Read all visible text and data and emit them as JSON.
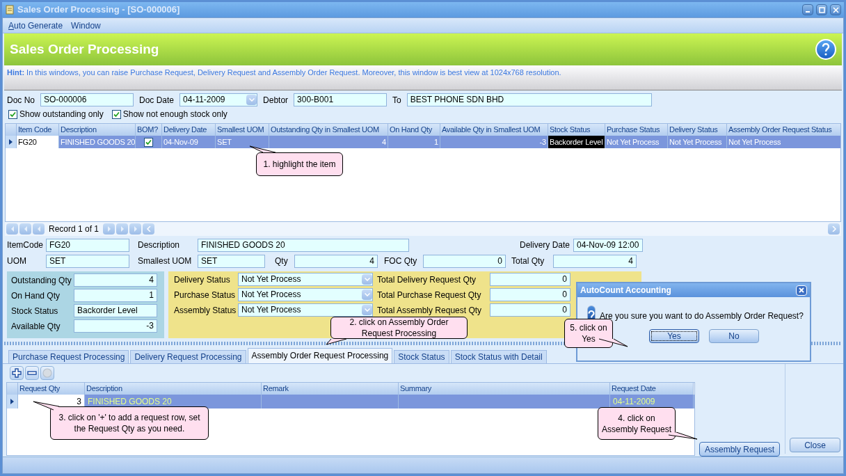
{
  "window": {
    "title": "Sales Order Processing - [SO-000006]"
  },
  "menu": [
    {
      "label": "Auto Generate",
      "mnemonic": true
    },
    {
      "label": "Window",
      "mnemonic": false
    }
  ],
  "header": {
    "title": "Sales Order Processing"
  },
  "hint": {
    "label": "Hint:",
    "text": "In this windows, you can raise Purchase Request, Delivery Request and Assembly Order Request. Moreover, this window is best view at 1024x768 resolution."
  },
  "doc_fields": [
    {
      "label": "Doc No",
      "value": "SO-000006",
      "kind": "text"
    },
    {
      "label": "Doc Date",
      "value": "04-11-2009",
      "kind": "date"
    },
    {
      "label": "Debtor",
      "value": "300-B001",
      "kind": "text"
    },
    {
      "label": "To",
      "value": "BEST PHONE SDN BHD",
      "kind": "wide"
    }
  ],
  "filters": [
    {
      "label": "Show outstanding only",
      "checked": true
    },
    {
      "label": "Show not enough stock only",
      "checked": true
    }
  ],
  "grid": {
    "columns": [
      {
        "label": "Item Code",
        "kind": "text"
      },
      {
        "label": "Description",
        "kind": "text"
      },
      {
        "label": "BOM?",
        "kind": "check"
      },
      {
        "label": "Delivery Date",
        "kind": "text"
      },
      {
        "label": "Smallest UOM",
        "kind": "text"
      },
      {
        "label": "Outstanding Qty in Smallest UOM",
        "kind": "number"
      },
      {
        "label": "On Hand Qty",
        "kind": "number"
      },
      {
        "label": "Available Qty in Smallest UOM",
        "kind": "number"
      },
      {
        "label": "Stock Status",
        "kind": "text"
      },
      {
        "label": "Purchase Status",
        "kind": "text"
      },
      {
        "label": "Delivery Status",
        "kind": "text"
      },
      {
        "label": "Assembly Order Request Status",
        "kind": "text"
      }
    ],
    "rows": [
      {
        "selected": true,
        "cells": [
          {
            "text": "FG20",
            "focused": true
          },
          {
            "text": "FINISHED GOODS 20"
          },
          {
            "checked": true
          },
          {
            "text": "04-Nov-09"
          },
          {
            "text": "SET"
          },
          {
            "text": "4"
          },
          {
            "text": "1"
          },
          {
            "text": "-3"
          },
          {
            "text": "Backorder Level",
            "highlighted": true
          },
          {
            "text": "Not Yet Process"
          },
          {
            "text": "Not Yet Process"
          },
          {
            "text": "Not Yet Process"
          }
        ]
      }
    ]
  },
  "navigator": {
    "text": "Record 1 of 1"
  },
  "detail": {
    "item_code": {
      "label": "ItemCode",
      "value": "FG20"
    },
    "description": {
      "label": "Description",
      "value": "FINISHED GOODS 20"
    },
    "delivery_date": {
      "label": "Delivery Date",
      "value": "04-Nov-09 12:00"
    },
    "uom": {
      "label": "UOM",
      "value": "SET"
    },
    "smallest_uom": {
      "label": "Smallest UOM",
      "value": "SET"
    },
    "qty": {
      "label": "Qty",
      "value": "4"
    },
    "foc_qty": {
      "label": "FOC Qty",
      "value": "0"
    },
    "total_qty": {
      "label": "Total Qty",
      "value": "4"
    }
  },
  "qty_panel": [
    {
      "label": "Outstanding Qty",
      "value": "4",
      "kind": "number"
    },
    {
      "label": "On Hand Qty",
      "value": "1",
      "kind": "number"
    },
    {
      "label": "Stock Status",
      "value": "Backorder Level",
      "kind": "text"
    },
    {
      "label": "Available Qty",
      "value": "-3",
      "kind": "number"
    }
  ],
  "status_panel": [
    {
      "label": "Delivery Status",
      "value": "Not Yet Process"
    },
    {
      "label": "Purchase Status",
      "value": "Not Yet Process"
    },
    {
      "label": "Assembly Status",
      "value": "Not Yet Process"
    }
  ],
  "totals_panel": [
    {
      "label": "Total Delivery Request Qty",
      "value": "0"
    },
    {
      "label": "Total Purchase Request Qty",
      "value": "0"
    },
    {
      "label": "Total Assembly Request Qty",
      "value": "0"
    }
  ],
  "tabs": [
    {
      "label": "Purchase Request Processing",
      "selected": false
    },
    {
      "label": "Delivery Request Processing",
      "selected": false
    },
    {
      "label": "Assembly Order Request Processing",
      "selected": true
    },
    {
      "label": "Stock Status",
      "selected": false
    },
    {
      "label": "Stock Status with Detail",
      "selected": false
    }
  ],
  "toolbar": [
    {
      "kind": "add",
      "disabled": false
    },
    {
      "kind": "remove",
      "disabled": false
    },
    {
      "kind": "clear",
      "disabled": true
    }
  ],
  "request_grid": {
    "columns": [
      {
        "label": "Request Qty"
      },
      {
        "label": "Description"
      },
      {
        "label": "Remark"
      },
      {
        "label": "Summary"
      },
      {
        "label": "Request Date"
      }
    ],
    "rows": [
      {
        "selected": true,
        "cells": [
          "3",
          "FINISHED GOODS 20",
          "",
          "",
          "04-11-2009"
        ]
      }
    ]
  },
  "buttons": [
    {
      "label": "Assembly Request",
      "kind": "assembly"
    },
    {
      "label": "Close",
      "kind": "close"
    }
  ],
  "dialog": {
    "title": "AutoCount Accounting",
    "message": "Are you sure you want to do Assembly Order Request?",
    "buttons": [
      {
        "label": "Yes",
        "focused": true
      },
      {
        "label": "No",
        "focused": false
      }
    ]
  },
  "callouts": [
    {
      "text": "1. highlight the item"
    },
    {
      "text": "2. click on Assembly Order Request Processing"
    },
    {
      "text": "3. click on '+' to add a request row, set the Request Qty as you need."
    },
    {
      "text": "4. click on Assembly Request"
    },
    {
      "text": "5. click on Yes"
    }
  ]
}
